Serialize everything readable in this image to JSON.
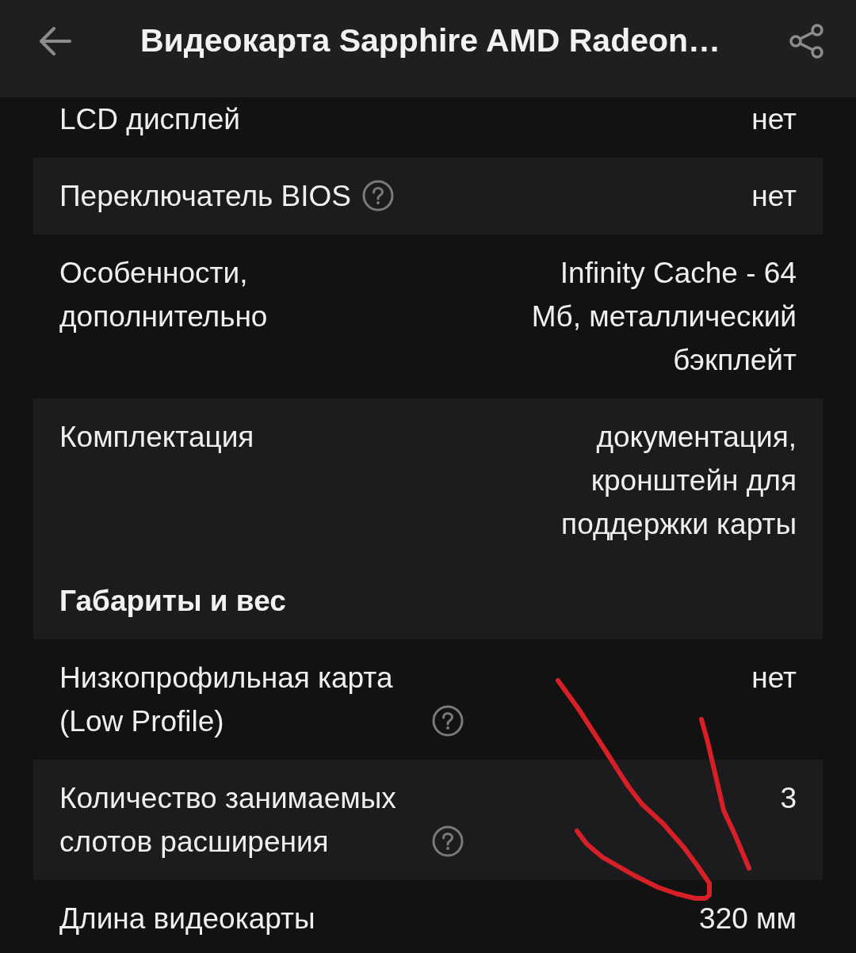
{
  "header": {
    "title": "Видеокарта Sapphire AMD Radeon…"
  },
  "specs": [
    {
      "kind": "spec",
      "label": "LCD дисплей",
      "help": false,
      "value": "нет"
    },
    {
      "kind": "spec",
      "label": "Переключатель BIOS",
      "help": true,
      "value": "нет"
    },
    {
      "kind": "spec",
      "label": "Особенности, дополнительно",
      "help": false,
      "value": "Infinity Cache - 64 Мб, металлический бэкплейт"
    },
    {
      "kind": "spec",
      "label": "Комплектация",
      "help": false,
      "value": "документация, кронштейн для поддержки карты"
    },
    {
      "kind": "heading",
      "title": "Габариты и вес"
    },
    {
      "kind": "spec",
      "label": "Низкопрофильная карта (Low Profile)",
      "help": true,
      "value": "нет"
    },
    {
      "kind": "spec",
      "label": "Количество занимаемых слотов расширения",
      "help": true,
      "value": "3"
    },
    {
      "kind": "spec",
      "label": "Длина видеокарты",
      "help": false,
      "value": "320 мм"
    }
  ]
}
